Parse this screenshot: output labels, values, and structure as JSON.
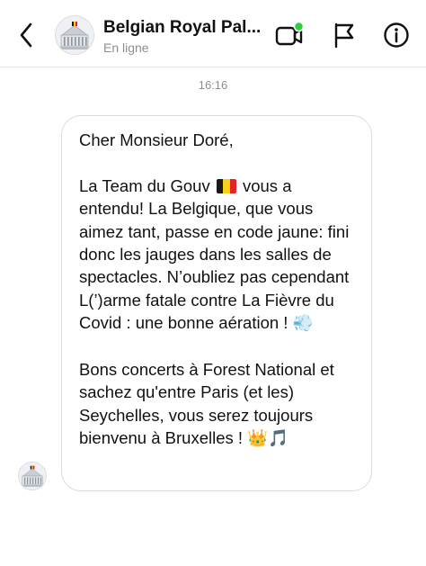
{
  "header": {
    "title": "Belgian Royal Pal...",
    "subtitle": "En ligne",
    "back_icon": "chevron-left-icon",
    "video_icon": "video-call-icon",
    "flag_icon": "flag-icon",
    "info_icon": "info-icon",
    "online_indicator_color": "#2ecc40"
  },
  "thread": {
    "timestamp": "16:16",
    "message": {
      "greeting": "Cher Monsieur Doré,",
      "p2_before_flag": "La Team du Gouv",
      "p2_flag": "belgian-flag-emoji",
      "p2_after_flag": " vous a entendu! La Belgique, que vous aimez tant, passe en code jaune: fini donc les jauges dans les salles de spectacles. N’oubliez pas cependant L(’)arme fatale contre La Fièvre du Covid : une bonne aération ! ",
      "p2_emoji": "💨",
      "p3_text": "Bons concerts à Forest National et sachez qu'entre Paris (et les) Seychelles, vous serez toujours bienvenu à Bruxelles ! ",
      "p3_emoji_1": "👑",
      "p3_emoji_2": "🎵"
    }
  },
  "colors": {
    "flag_black": "#1a1a1a",
    "flag_yellow": "#f7d117",
    "flag_red": "#e3232c",
    "bubble_border": "#dbdbdb",
    "secondary_text": "#8e8e8e"
  }
}
